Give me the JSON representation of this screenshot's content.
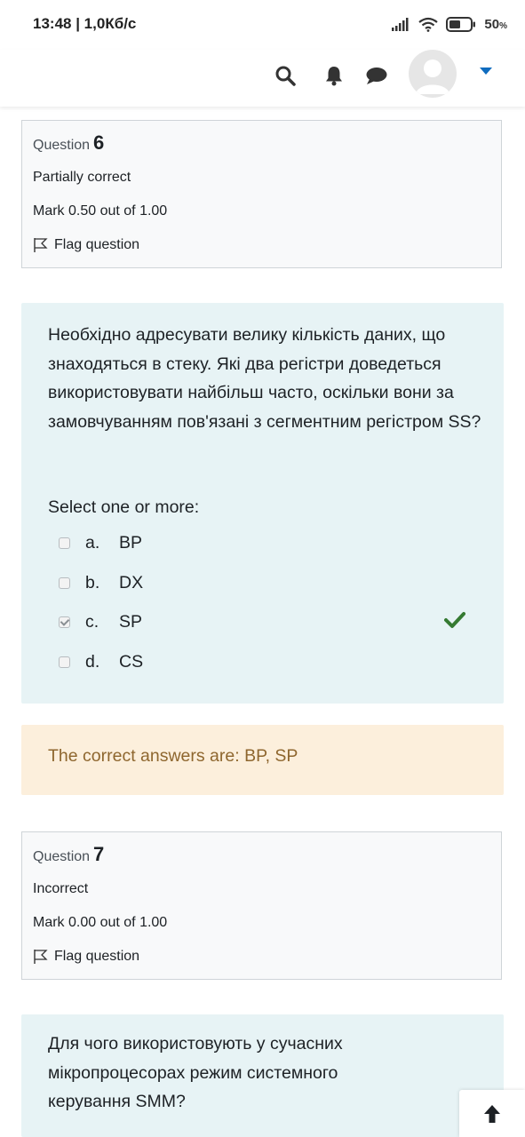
{
  "status_bar": {
    "time": "13:48 | 1,0Кб/с",
    "battery": "50",
    "battery_unit": "%"
  },
  "header": {
    "icons": [
      "search-icon",
      "bell-icon",
      "chat-icon",
      "user-avatar",
      "chevron-down-icon"
    ]
  },
  "questions": [
    {
      "label": "Question",
      "number": "6",
      "state": "Partially correct",
      "mark": "Mark 0.50 out of 1.00",
      "flag": "Flag question",
      "text": "Необхідно адресувати велику кількість даних, що знаходяться в стеку. Які два регістри доведеться використовувати найбільш часто, оскільки вони за замовчуванням пов'язані з сегментним регістром SS?",
      "prompt": "Select one or more:",
      "options": [
        {
          "letter": "a.",
          "text": "BP",
          "checked": false
        },
        {
          "letter": "b.",
          "text": "DX",
          "checked": false
        },
        {
          "letter": "c.",
          "text": "SP",
          "checked": true,
          "correct": true
        },
        {
          "letter": "d.",
          "text": "CS",
          "checked": false
        }
      ],
      "feedback": "The correct answers are: BP, SP"
    },
    {
      "label": "Question",
      "number": "7",
      "state": "Incorrect",
      "mark": "Mark 0.00 out of 1.00",
      "flag": "Flag question",
      "text": "Для чого використовують у сучасних мікропроцесорах режим системного керування SMM?"
    }
  ],
  "colors": {
    "info_bg": "#f8f9fa",
    "content_bg": "#e7f3f5",
    "feedback_bg": "#fcefdc",
    "feedback_text": "#8e662e",
    "tick": "#357a32",
    "accent": "#0f6cbf"
  }
}
